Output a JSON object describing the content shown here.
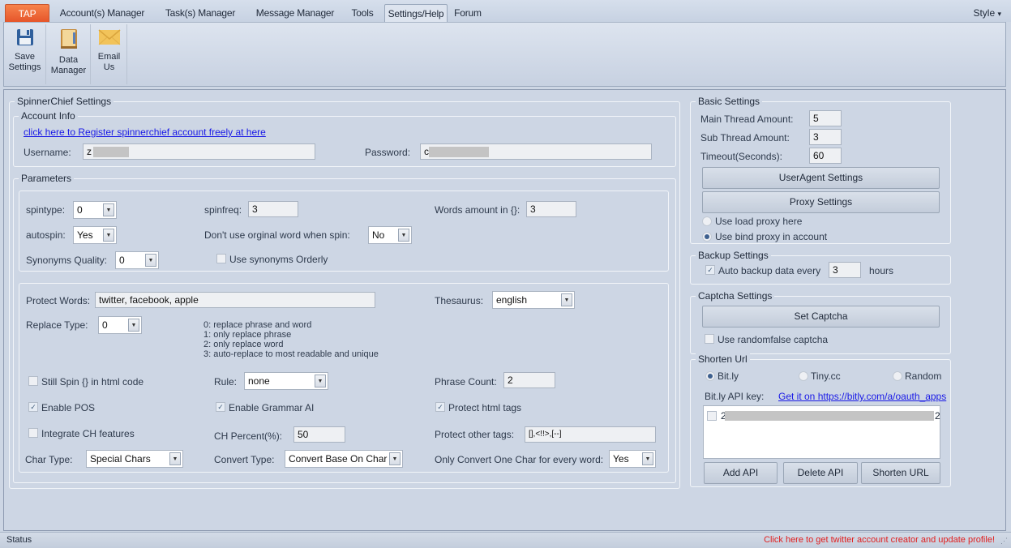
{
  "menu": {
    "tabs": [
      {
        "label": "TAP",
        "kind": "app"
      },
      {
        "label": "Account(s) Manager"
      },
      {
        "label": "Task(s) Manager"
      },
      {
        "label": "Message Manager"
      },
      {
        "label": "Tools"
      },
      {
        "label": "Settings/Help",
        "active": true
      },
      {
        "label": "Forum"
      }
    ],
    "style_label": "Style",
    "style_arrow": "▾"
  },
  "ribbon": {
    "save": {
      "line1": "Save",
      "line2": "Settings",
      "icon": "floppy-disk-icon"
    },
    "data": {
      "line1": "Data",
      "line2": "Manager",
      "icon": "folder-icon"
    },
    "email": {
      "line1": "Email",
      "line2": "Us",
      "icon": "envelope-icon"
    }
  },
  "spinnerchief": {
    "title": "SpinnerChief Settings",
    "account": {
      "title": "Account Info",
      "register_link": "click here to Register spinnerchief account freely at here",
      "username_label": "Username:",
      "username_value": "z",
      "password_label": "Password:",
      "password_value": "c"
    },
    "parameters": {
      "title": "Parameters",
      "spintype_label": "spintype:",
      "spintype_value": "0",
      "spinfreq_label": "spinfreq:",
      "spinfreq_value": "3",
      "words_amount_label": "Words amount in {}:",
      "words_amount_value": "3",
      "autospin_label": "autospin:",
      "autospin_value": "Yes",
      "dont_use_label": "Don't use orginal word when spin:",
      "dont_use_value": "No",
      "syn_quality_label": "Synonyms Quality:",
      "syn_quality_value": "0",
      "syn_orderly_label": "Use synonyms Orderly",
      "syn_orderly_checked": false,
      "protect_words_label": "Protect Words:",
      "protect_words_value": "twitter, facebook, apple",
      "thesaurus_label": "Thesaurus:",
      "thesaurus_value": "english",
      "replace_type_label": "Replace Type:",
      "replace_type_value": "0",
      "replace_hints": [
        "0: replace phrase and word",
        "1: only replace phrase",
        "2: only replace word",
        "3: auto-replace to most readable and unique"
      ],
      "still_spin_label": "Still Spin {} in html code",
      "still_spin_checked": false,
      "rule_label": "Rule:",
      "rule_value": "none",
      "phrase_count_label": "Phrase Count:",
      "phrase_count_value": "2",
      "enable_pos_label": "Enable POS",
      "enable_pos_checked": true,
      "grammar_ai_label": "Enable Grammar AI",
      "grammar_ai_checked": true,
      "protect_html_label": "Protect html tags",
      "protect_html_checked": true,
      "integrate_ch_label": "Integrate CH features",
      "integrate_ch_checked": false,
      "ch_percent_label": "CH Percent(%):",
      "ch_percent_value": "50",
      "protect_other_label": "Protect other tags:",
      "protect_other_value": "[],<!!>,[--]",
      "char_type_label": "Char Type:",
      "char_type_value": "Special Chars",
      "convert_type_label": "Convert Type:",
      "convert_type_value": "Convert Base On Char",
      "only_convert_label": "Only Convert One Char for every word:",
      "only_convert_value": "Yes"
    }
  },
  "basic": {
    "title": "Basic Settings",
    "main_thread_label": "Main Thread Amount:",
    "main_thread_value": "5",
    "sub_thread_label": "Sub Thread Amount:",
    "sub_thread_value": "3",
    "timeout_label": "Timeout(Seconds):",
    "timeout_value": "60",
    "useragent_button": "UserAgent Settings",
    "proxy_button": "Proxy Settings",
    "load_proxy_label": "Use load proxy here",
    "bind_proxy_label": "Use bind proxy in account",
    "selected_proxy": "bind"
  },
  "backup": {
    "title": "Backup Settings",
    "auto_label": "Auto backup data every",
    "auto_checked": true,
    "hours_value": "3",
    "hours_label": "hours"
  },
  "captcha": {
    "title": "Captcha Settings",
    "set_button": "Set Captcha",
    "random_false_label": "Use randomfalse captcha",
    "random_false_checked": false
  },
  "shorten": {
    "title": "Shorten Url",
    "options": [
      "Bit.ly",
      "Tiny.cc",
      "Random"
    ],
    "selected": "Bit.ly",
    "api_key_label": "Bit.ly API key:",
    "api_link": "Get it on https://bitly.com/a/oauth_apps",
    "api_items": [
      {
        "prefix": "2",
        "suffix": "2",
        "checked": false
      }
    ],
    "add_button": "Add API",
    "delete_button": "Delete API",
    "shorten_button": "Shorten URL"
  },
  "status": {
    "text": "Status",
    "promo_link": "Click here to get twitter account creator and update profile!",
    "promo_color": "#e02020"
  },
  "colors": {
    "app_tab": "#ee6a37",
    "background": "#cdd6e4",
    "link": "#1a1ae6"
  }
}
